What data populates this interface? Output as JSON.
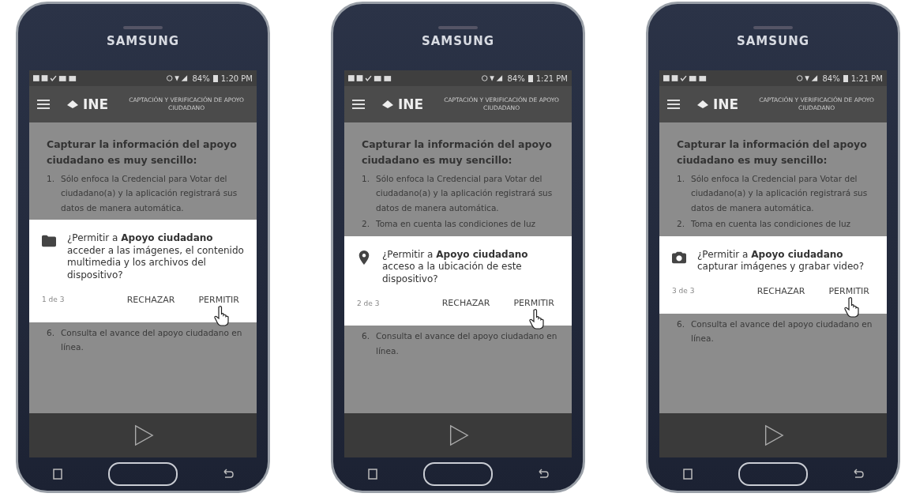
{
  "phones": [
    {
      "brand": "SAMSUNG",
      "status": {
        "battery": "84%",
        "time": "1:20 PM"
      },
      "app_bar": {
        "logo": "INE",
        "title": "CAPTACIÓN Y VERIFICACIÓN DE APOYO CIUDADANO"
      },
      "heading": "Capturar la información del apoyo ciudadano es muy sencillo:",
      "steps": [
        {
          "number": "1.",
          "text": "Sólo enfoca la Credencial para Votar del ciudadano(a) y la aplicación registrará sus datos de manera automática."
        }
      ],
      "dialog": {
        "kind": "folder",
        "message": "¿Permitir a **Apoyo ciudadano** acceder a las imágenes, el contenido multimedia y los archivos del dispositivo?",
        "counter": "1 de 3",
        "buttons": [
          "RECHAZAR",
          "PERMITIR"
        ]
      },
      "steps_after": [
        {
          "number": "6.",
          "text": "Consulta el avance del apoyo ciudadano en línea."
        }
      ]
    },
    {
      "brand": "SAMSUNG",
      "status": {
        "battery": "84%",
        "time": "1:21 PM"
      },
      "app_bar": {
        "logo": "INE",
        "title": "CAPTACIÓN Y VERIFICACIÓN DE APOYO CIUDADANO"
      },
      "heading": "Capturar la información del apoyo ciudadano es muy sencillo:",
      "steps": [
        {
          "number": "1.",
          "text": "Sólo enfoca la Credencial para Votar del ciudadano(a) y la aplicación registrará sus datos de manera automática."
        },
        {
          "number": "2.",
          "text": "Toma en cuenta las condiciones de luz"
        }
      ],
      "dialog": {
        "kind": "location",
        "message": "¿Permitir a **Apoyo ciudadano** acceso a la ubicación de este dispositivo?",
        "counter": "2 de 3",
        "buttons": [
          "RECHAZAR",
          "PERMITIR"
        ]
      },
      "steps_after": [
        {
          "number": "6.",
          "text": "Consulta el avance del apoyo ciudadano en línea."
        }
      ]
    },
    {
      "brand": "SAMSUNG",
      "status": {
        "battery": "84%",
        "time": "1:21 PM"
      },
      "app_bar": {
        "logo": "INE",
        "title": "CAPTACIÓN Y VERIFICACIÓN DE APOYO CIUDADANO"
      },
      "heading": "Capturar la información del apoyo ciudadano es muy sencillo:",
      "steps": [
        {
          "number": "1.",
          "text": "Sólo enfoca la Credencial para Votar del ciudadano(a) y la aplicación registrará sus datos de manera automática."
        },
        {
          "number": "2.",
          "text": "Toma en cuenta las condiciones de luz"
        }
      ],
      "dialog": {
        "kind": "camera",
        "message": "¿Permitir a **Apoyo ciudadano** capturar imágenes y grabar video?",
        "counter": "3 de 3",
        "buttons": [
          "RECHAZAR",
          "PERMITIR"
        ]
      },
      "steps_after": [
        {
          "number": "6.",
          "text": "Consulta el avance del apoyo ciudadano en línea."
        }
      ]
    }
  ]
}
